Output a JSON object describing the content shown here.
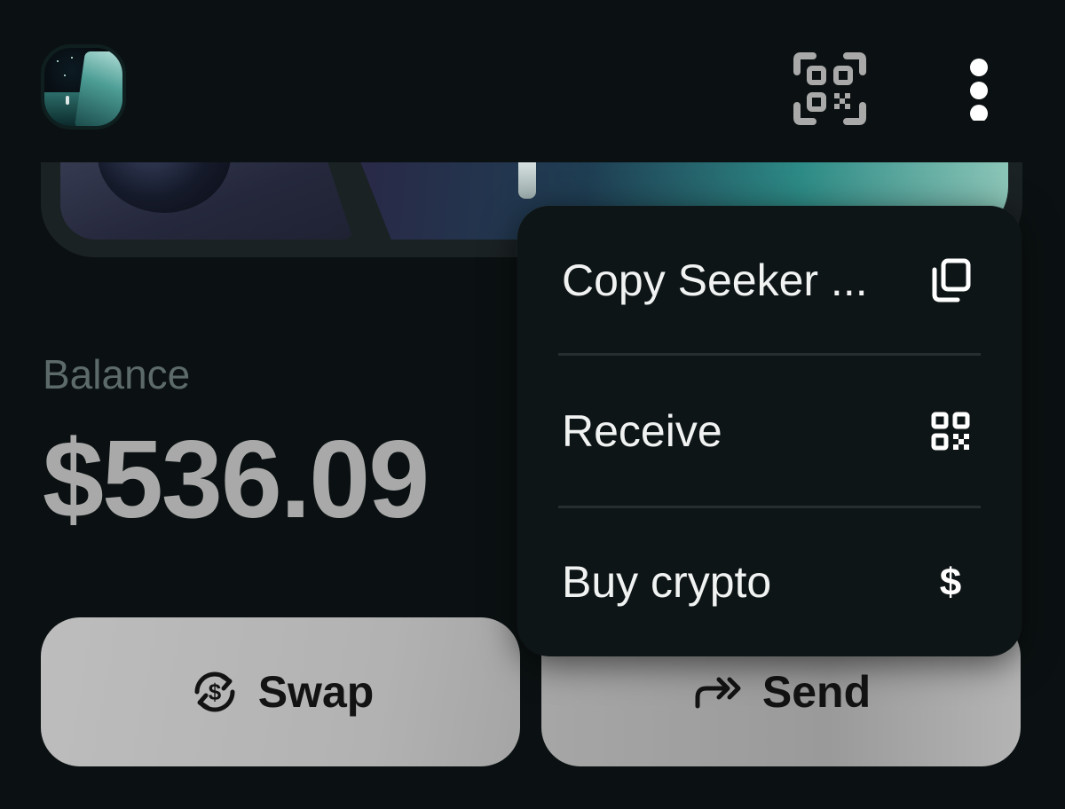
{
  "header": {
    "avatar_icon": "wallet-avatar-image",
    "scan_icon": "qr-scan-icon",
    "more_icon": "more-vertical-icon"
  },
  "balance": {
    "label": "Balance",
    "value": "$536.09"
  },
  "actions": {
    "swap_label": "Swap",
    "swap_icon": "swap-dollar-icon",
    "send_label": "Send",
    "send_icon": "send-arrows-icon"
  },
  "menu": {
    "items": [
      {
        "label": "Copy Seeker ...",
        "icon": "copy-icon"
      },
      {
        "label": "Receive",
        "icon": "qr-code-icon"
      },
      {
        "label": "Buy crypto",
        "icon": "dollar-icon"
      }
    ]
  },
  "colors": {
    "background": "#0b1112",
    "menu_background": "#0e1516",
    "menu_text": "#f1f3f3",
    "balance_text": "#a9a9a9",
    "balance_label": "#5d6a6a",
    "button_fill": "#b5b5b5"
  }
}
